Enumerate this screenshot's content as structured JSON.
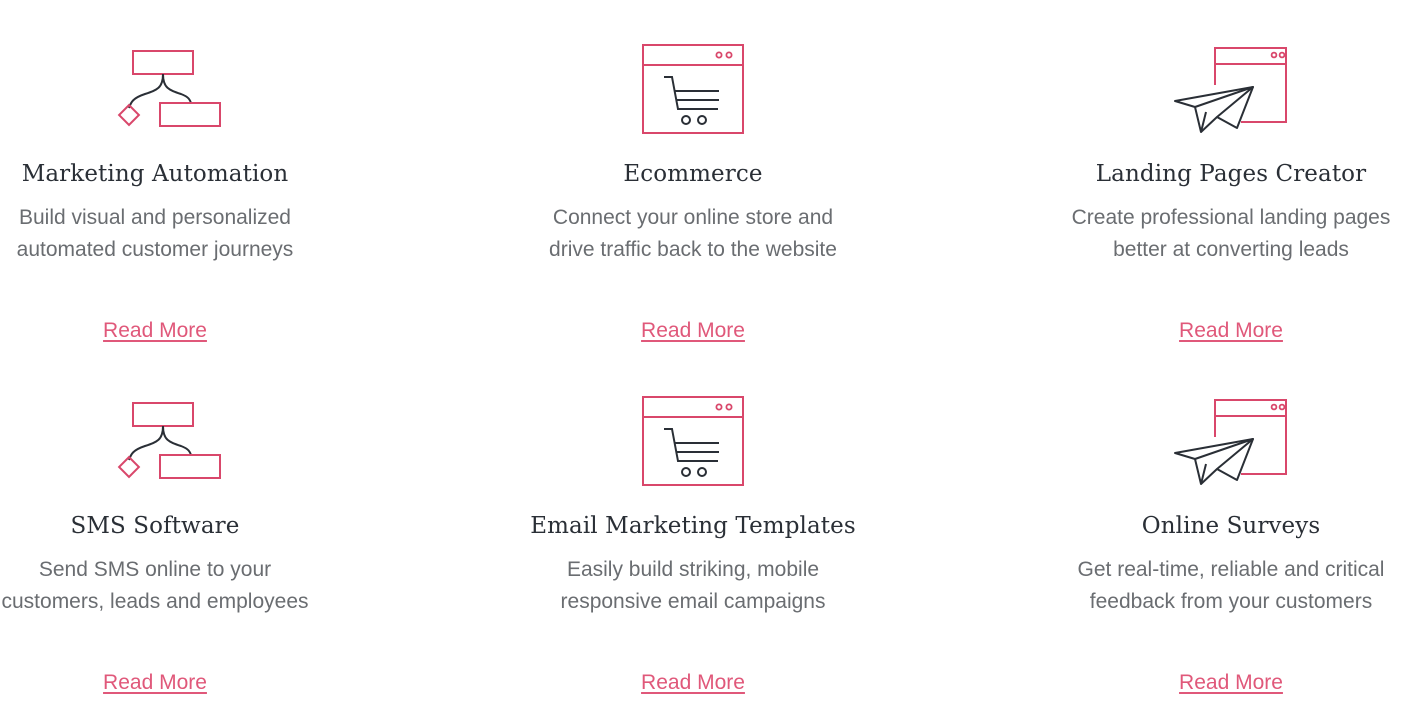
{
  "colors": {
    "accent": "#d9476b",
    "icon_dark": "#2a2f36",
    "title": "#2a2f36",
    "text": "#6a6d71",
    "link": "#e0587a"
  },
  "features": [
    {
      "icon": "flowchart-icon",
      "title": "Marketing Automation",
      "desc": [
        "Build visual and personalized",
        "automated customer journeys"
      ],
      "link": "Read More"
    },
    {
      "icon": "shopping-cart-browser-icon",
      "title": "Ecommerce",
      "desc": [
        "Connect your online store and",
        "drive traffic back to the website"
      ],
      "link": "Read More"
    },
    {
      "icon": "paper-plane-browser-icon",
      "title": "Landing Pages Creator",
      "desc": [
        "Create professional landing pages",
        "better at converting leads"
      ],
      "link": "Read More"
    },
    {
      "icon": "flowchart-icon",
      "title": "SMS Software",
      "desc": [
        "Send SMS online to your",
        "customers, leads and employees"
      ],
      "link": "Read More"
    },
    {
      "icon": "shopping-cart-browser-icon",
      "title": "Email Marketing Templates",
      "desc": [
        "Easily build striking, mobile",
        "responsive email campaigns"
      ],
      "link": "Read More"
    },
    {
      "icon": "paper-plane-browser-icon",
      "title": "Online Surveys",
      "desc": [
        "Get real-time, reliable and critical",
        "feedback from your customers"
      ],
      "link": "Read More"
    }
  ]
}
